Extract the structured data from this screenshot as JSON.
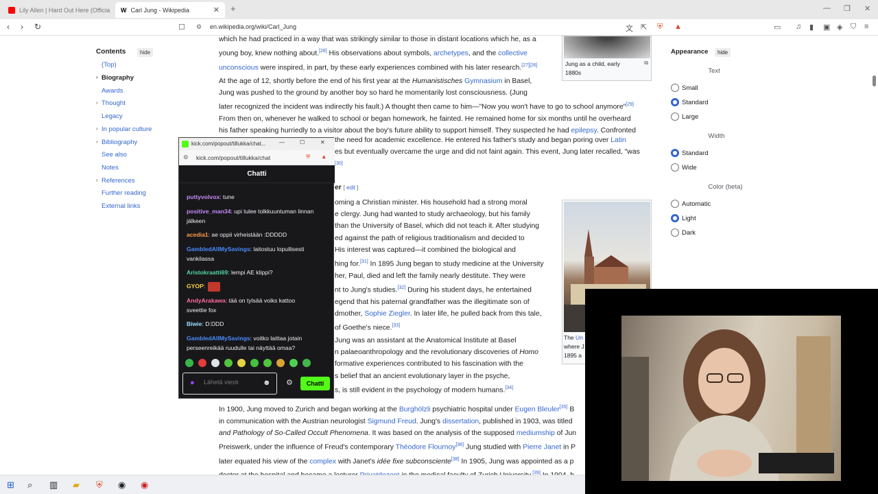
{
  "tabs": [
    {
      "label": "Lily Allen | Hard Out Here (Officia"
    },
    {
      "label": "Carl Jung - Wikipedia"
    }
  ],
  "address_url": "en.wikipedia.org/wiki/Carl_Jung",
  "toc": {
    "title": "Contents",
    "hide_label": "hide",
    "items": [
      "(Top)",
      "Biography",
      "Awards",
      "Thought",
      "Legacy",
      "In popular culture",
      "Bibliography",
      "See also",
      "Notes",
      "References",
      "Further reading",
      "External links"
    ]
  },
  "article": {
    "p1_line1": "which he had practiced in a way that was strikingly similar to those in distant locations which he, as a",
    "p1_line2a": "young boy, knew nothing about.",
    "p1_sup1": "[28]",
    "p1_line2b": " His observations about symbols, ",
    "p1_link1": "archetypes",
    "p1_line2c": ", and the ",
    "p1_link2": "collective",
    "p1_link3": "unconscious",
    "p1_line3b": " were inspired, in part, by these early experiences combined with his later research.",
    "p1_sup2": "[27][26]",
    "p2_line1a": "At the age of 12, shortly before the end of his first year at the ",
    "p2_italic": "Humanistisches",
    "p2_link": "Gymnasium",
    "p2_line1b": " in Basel,",
    "p2_line2": "Jung was pushed to the ground by another boy so hard he momentarily lost consciousness. (Jung",
    "p2_line3": "later recognized the incident was indirectly his fault.) A thought then came to him—\"Now you won't have to go to school anymore\"",
    "p2_sup": "[29]",
    "p2_line4": "From then on, whenever he walked to school or began homework, he fainted. He remained home for six months until he overheard",
    "p2_line5a": "his father speaking hurriedly to a visitor about the boy's future ability to support himself. They suspected he had ",
    "p2_link2": "epilepsy",
    "p2_line5b": ". Confronted",
    "p2_line6a": "the need for academic excellence. He entered his father's study and began poring over ",
    "p2_link3": "Latin",
    "p2_line7": "es but eventually overcame the urge and did not faint again. This event, Jung later recalled, \"was",
    "p2_sup2": "[30]",
    "section_title": "er",
    "section_edit": "edit",
    "p3_line1": "oming a Christian minister. His household had a strong moral",
    "p3_line2": "e clergy. Jung had wanted to study archaeology, but his family",
    "p3_line3": "than the University of Basel, which did not teach it. After studying",
    "p3_line4": "ed against the path of religious traditionalism and decided to",
    "p3_line5": " His interest was captured—it combined the biological and",
    "p3_line6a": "hing for.",
    "p3_sup1": "[31]",
    "p3_line6b": " In 1895 Jung began to study medicine at the University",
    "p3_line7": "her, Paul, died and left the family nearly destitute. They were",
    "p3_line8a": "nt to Jung's studies.",
    "p3_sup2": "[32]",
    "p3_line8b": " During his student days, he entertained",
    "p3_line9": "egend that his paternal grandfather was the illegitimate son of",
    "p3_line10a": "dmother, ",
    "p3_link1": "Sophie Ziegler",
    "p3_line10b": ". In later life, he pulled back from this tale,",
    "p3_line11a": "of Goethe's niece.",
    "p3_sup3": "[33]",
    "p4_line1": " Jung was an assistant at the Anatomical Institute at Basel",
    "p4_line2a": "n palaeoanthropology and the revolutionary discoveries of ",
    "p4_italic": "Homo",
    "p4_line3": "formative experiences contributed to his fascination with the",
    "p4_line4": "s belief that an ancient evolutionary layer in the psyche,",
    "p4_line5a": "s, is still evident in the psychology of modern humans.",
    "p4_sup": "[34]",
    "p5_line1a": "In 1900, Jung moved to Zurich and began working at the ",
    "p5_link1": "Burghölzli",
    "p5_line1b": " psychiatric hospital under ",
    "p5_link2": "Eugen Bleuler",
    "p5_sup1": "[35]",
    "p5_line1c": " B",
    "p5_line2a": "in communication with the Austrian neurologist ",
    "p5_link3": "Sigmund Freud",
    "p5_line2b": ". Jung's ",
    "p5_link4": "dissertation",
    "p5_line2c": ", published in 1903, was titled",
    "p5_line3a": "and Pathology of So-Called Occult Phenomena",
    "p5_line3b": ". It was based on the analysis of the supposed ",
    "p5_link5": "mediumship",
    "p5_line3c": " of Jun",
    "p5_line4a": "Preiswerk, under the influence of Freud's contemporary ",
    "p5_link6": "Théodore Flournoy",
    "p5_sup2": "[36]",
    "p5_line4b": " Jung studied with ",
    "p5_link7": "Pierre Janet",
    "p5_line4c": " in P",
    "p5_line5a": "later equated his view of the ",
    "p5_link8": "complex",
    "p5_line5b": " with Janet's ",
    "p5_italic2": "idée fixe subconsciente",
    "p5_sup3": "[38]",
    "p5_line5c": " In 1905, Jung was appointed as a p",
    "p5_line6a": "doctor at the hospital and became a lecturer ",
    "p5_link9": "Privatdozent",
    "p5_line6b": " in the medical faculty of Zurich University.",
    "p5_sup4": "[39]",
    "p5_line6c": " In 1904, h"
  },
  "figures": {
    "fig1_caption_line1": "Jung as a child, early",
    "fig1_caption_line2": "1880s",
    "fig2_caption_a": "The ",
    "fig2_caption_link": "Un",
    "fig2_caption_b": "where J",
    "fig2_caption_c": "1895 a"
  },
  "appearance": {
    "title": "Appearance",
    "hide_label": "hide",
    "text_heading": "Text",
    "text_options": [
      "Small",
      "Standard",
      "Large"
    ],
    "text_selected": "Standard",
    "width_heading": "Width",
    "width_options": [
      "Standard",
      "Wide"
    ],
    "width_selected": "Standard",
    "color_heading": "Color (beta)",
    "color_options": [
      "Automatic",
      "Light",
      "Dark"
    ],
    "color_selected": "Light"
  },
  "chat": {
    "window_title": "kick.com/popout/tillukka/chat...",
    "url": "kick.com/popout/tillukka/chat",
    "header": "Chatti",
    "messages": [
      {
        "user": "puttyvolvox",
        "color": "#c58af9",
        "text": ": tune"
      },
      {
        "user": "positive_man34",
        "color": "#c58af9",
        "text": ": upi tulee tolkkuuntuman linnan"
      },
      {
        "user": "",
        "color": "#efeff1",
        "text": "jälkeen"
      },
      {
        "user": "acedia1",
        "color": "#ff9c4a",
        "text": ": ae oppii virheistään :DDDDD"
      },
      {
        "user": "GambledAllMySavings",
        "color": "#4a8cff",
        "text": ": laitostuu lopullisesti"
      },
      {
        "user": "",
        "color": "#efeff1",
        "text": "vankilassa"
      },
      {
        "user": "Aristokraatti69",
        "color": "#54d6a0",
        "text": ": lempi AE klippi?"
      },
      {
        "user": "GYOP",
        "color": "#ffd33d",
        "text": ":"
      },
      {
        "user": "AndyArakawa",
        "color": "#ff6b9d",
        "text": ": tää on tylsää voiks kattoo"
      },
      {
        "user": "",
        "color": "#efeff1",
        "text": "sveettie fox"
      },
      {
        "user": "Biwie",
        "color": "#9be0ff",
        "text": ": D:DDD"
      },
      {
        "user": "GambledAllMySavings",
        "color": "#4a8cff",
        "text": ": voitko laittaa jotain"
      },
      {
        "user": "",
        "color": "#efeff1",
        "text": "perseenreikää ruudulle tai näyttää omaa?"
      }
    ],
    "input_placeholder": "Lähetä viesti",
    "send_label": "Chatti"
  },
  "colors": {
    "link": "#3366cc",
    "kick_green": "#53fc18",
    "chat_bg": "#18181b"
  }
}
